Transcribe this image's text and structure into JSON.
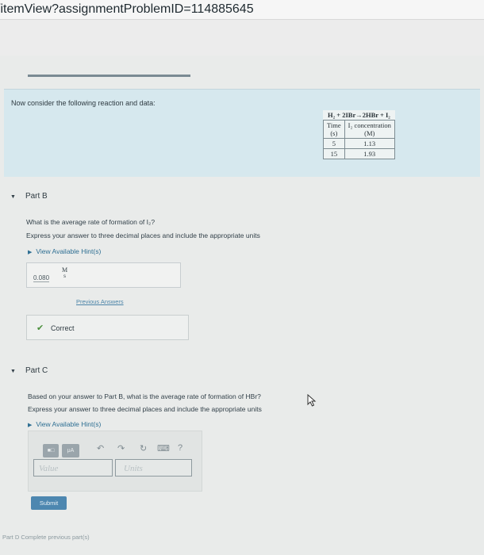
{
  "url": "/itemView?assignmentProblemID=114885645",
  "progress_fraction": 1.0,
  "intro": {
    "text": "Now consider the following reaction and data:",
    "table": {
      "equation": "H₂ + 2IBr→2HBr + I₂",
      "col1_header": "Time",
      "col1_unit": "(s)",
      "col2_header": "I₂ concentration",
      "col2_unit": "(M)",
      "rows": [
        {
          "time": "5",
          "conc": "1.13"
        },
        {
          "time": "15",
          "conc": "1.93"
        }
      ]
    }
  },
  "partB": {
    "title": "Part B",
    "question": "What is the average rate of formation of I₂?",
    "instruction": "Express your answer to three decimal places and include the appropriate units",
    "hint_link": "View Available Hint(s)",
    "answer_value": "0.080",
    "answer_unit": "M",
    "answer_unit_sub": "s",
    "previous_answers": "Previous Answers",
    "feedback": "Correct"
  },
  "partC": {
    "title": "Part C",
    "question": "Based on your answer to Part B, what is the average rate of formation of HBr?",
    "instruction": "Express your answer to three decimal places and include the appropriate units",
    "hint_link": "View Available Hint(s)",
    "value_placeholder": "Value",
    "units_placeholder": "Units",
    "submit_label": "Submit",
    "toolbar": {
      "templates_label": "■□",
      "mu_label": "μA",
      "undo": "↶",
      "redo": "↷",
      "reset": "↻",
      "keyboard": "⌨",
      "help": "?"
    }
  },
  "footer_link": "Part D  Complete previous part(s)"
}
